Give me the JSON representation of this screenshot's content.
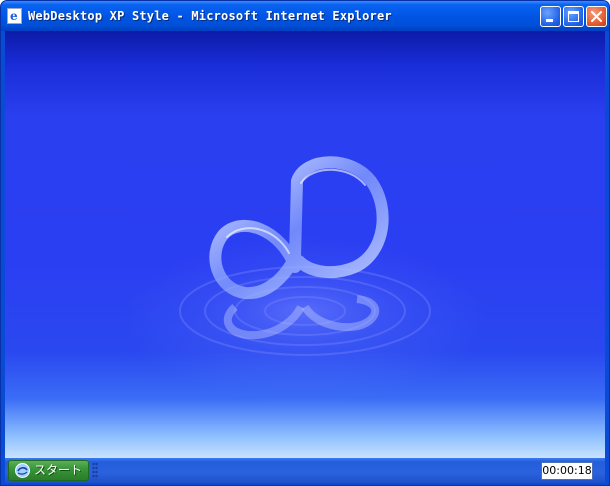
{
  "window": {
    "title": "WebDesktop XP Style - Microsoft Internet Explorer",
    "icon": "internet-explorer-icon",
    "buttons": [
      "minimize-icon",
      "maximize-icon",
      "close-icon"
    ]
  },
  "desktop": {
    "wallpaper": "infinity-logo-wallpaper",
    "colors": {
      "deep": "#0c1ba8",
      "main": "#2b3ff2",
      "glow": "#c9e2ff"
    }
  },
  "taskbar": {
    "start_label": "スタート",
    "start_icon": "start-logo-icon",
    "clock": "00:00:18"
  }
}
